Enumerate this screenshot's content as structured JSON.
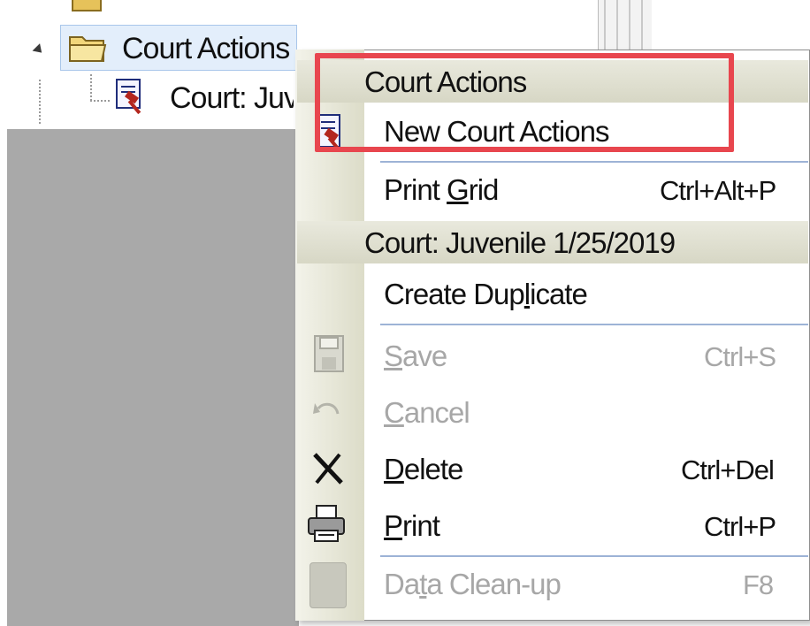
{
  "tree": {
    "selected_node": {
      "label": "Court Actions"
    },
    "child_node": {
      "label": "Court: Juv"
    }
  },
  "menu": {
    "section_court_actions": "Court Actions",
    "new_court_actions": "New Court Actions",
    "print_grid": {
      "label_pre": "Print ",
      "label_ul": "G",
      "label_post": "rid",
      "shortcut": "Ctrl+Alt+P"
    },
    "section_record": "Court: Juvenile 1/25/2019",
    "create_duplicate": {
      "label_pre": "Create Dup",
      "label_ul": "l",
      "label_post": "icate"
    },
    "save": {
      "label_ul": "S",
      "label_post": "ave",
      "shortcut": "Ctrl+S"
    },
    "cancel": {
      "label_ul": "C",
      "label_post": "ancel"
    },
    "delete": {
      "label_ul": "D",
      "label_post": "elete",
      "shortcut": "Ctrl+Del"
    },
    "print": {
      "label_ul": "P",
      "label_post": "rint",
      "shortcut": "Ctrl+P"
    },
    "data_cleanup": {
      "label_pre": "Da",
      "label_ul": "t",
      "label_post": "a Clean-up",
      "shortcut": "F8"
    }
  },
  "colors": {
    "highlight_box": "#e8464e",
    "separator": "#9db3d6",
    "disabled_text": "#a7a7a7"
  }
}
